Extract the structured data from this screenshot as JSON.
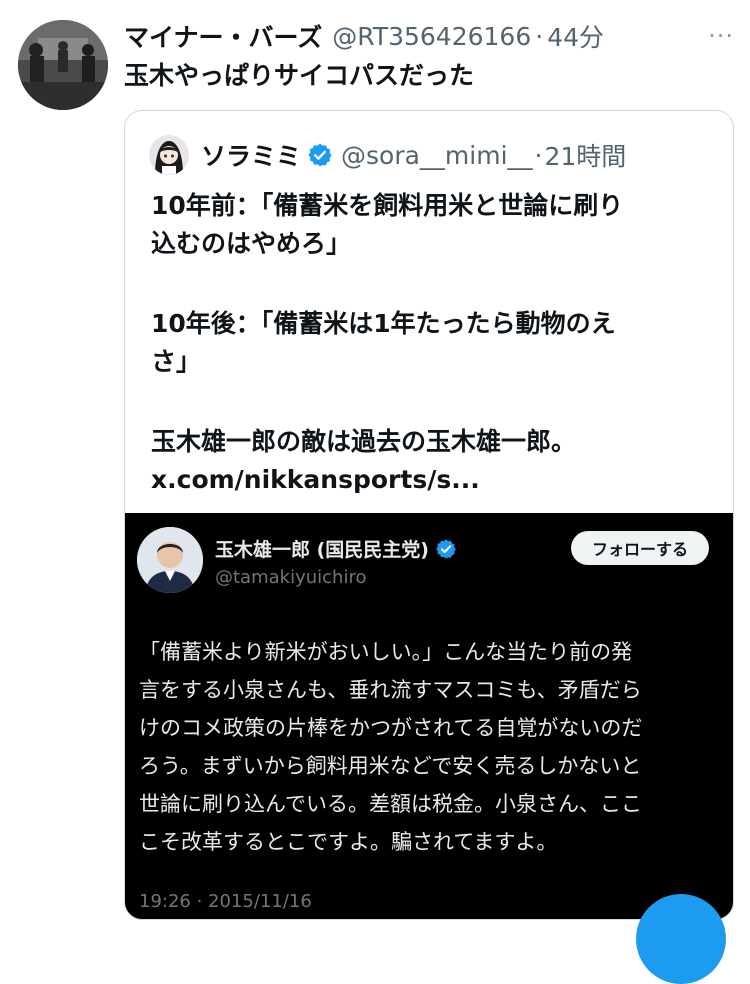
{
  "tweet": {
    "display_name": "マイナー・バーズ",
    "handle": "@RT356426166",
    "separator": "·",
    "time": "44分",
    "more": "···",
    "text": "玉木やっぱりサイコパスだった"
  },
  "quote": {
    "display_name": "ソラミミ",
    "handle": "@sora__mimi__",
    "separator": "·",
    "time": "21時間",
    "lines": [
      "10年前：「備蓄米を飼料用米と世論に刷り",
      "込むのはやめろ」",
      "10年後：「備蓄米は1年たったら動物のえ",
      "さ」",
      "玉木雄一郎の敵は過去の玉木雄一郎。",
      "x.com/nikkansports/s..."
    ]
  },
  "embed": {
    "display_name": "玉木雄一郎 (国民民主党)",
    "handle": "@tamakiyuichiro",
    "follow_label": "フォローする",
    "lines": [
      "「備蓄米より新米がおいしい。」こんな当たり前の発",
      "言をする小泉さんも、垂れ流すマスコミも、矛盾だら",
      "けのコメ政策の片棒をかつがされてる自覚がないのだ",
      "ろう。まずいから飼料用米などで安く売るしかないと",
      "世論に刷り込んでいる。差額は税金。小泉さん、ここ",
      "こそ改革するとこですよ。騙されてますよ。"
    ],
    "date": "19:26 · 2015/11/16"
  },
  "colors": {
    "verified": "#1d9bf0",
    "secondary_text": "#536471",
    "embed_background": "#000000"
  },
  "icons": [
    "verified-badge-icon",
    "more-options-icon"
  ]
}
